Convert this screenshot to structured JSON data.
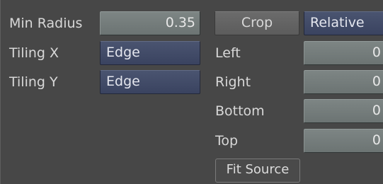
{
  "left_group": {
    "min_radius": {
      "label": "Min Radius",
      "value": "0.35"
    },
    "tiling_x": {
      "label": "Tiling X",
      "value": "Edge"
    },
    "tiling_y": {
      "label": "Tiling Y",
      "value": "Edge"
    }
  },
  "crop_group": {
    "crop_label": "Crop",
    "mode_value": "Relative",
    "left": {
      "label": "Left",
      "value": "0"
    },
    "right": {
      "label": "Right",
      "value": "0"
    },
    "bottom": {
      "label": "Bottom",
      "value": "0"
    },
    "top": {
      "label": "Top",
      "value": "0"
    },
    "fit_source_label": "Fit Source"
  }
}
